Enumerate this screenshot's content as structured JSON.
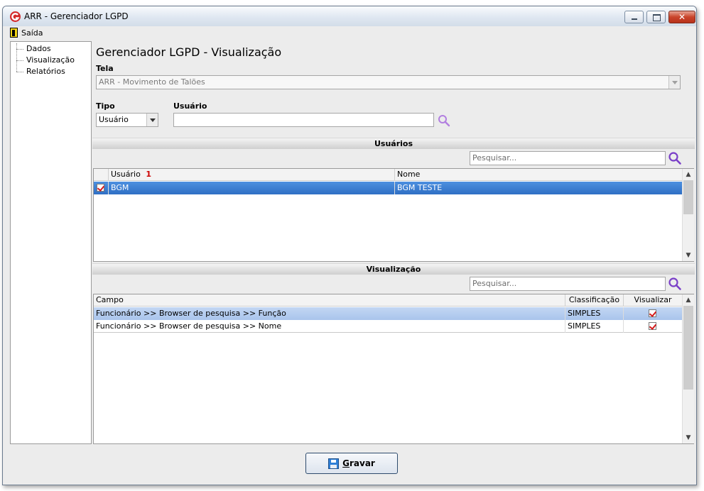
{
  "window": {
    "title": "ARR - Gerenciador LGPD"
  },
  "menu": {
    "exit_label": "Saída"
  },
  "sidebar": {
    "items": [
      {
        "label": "Dados"
      },
      {
        "label": "Visualização"
      },
      {
        "label": "Relatórios"
      }
    ]
  },
  "main": {
    "title": "Gerenciador LGPD - Visualização",
    "screen_label": "Tela",
    "screen_value": "ARR - Movimento de Talões",
    "type_label": "Tipo",
    "type_value": "Usuário",
    "user_label": "Usuário",
    "user_value": ""
  },
  "users_section": {
    "title": "Usuários",
    "search_placeholder": "Pesquisar...",
    "columns": [
      "Usuário",
      "Nome"
    ],
    "sort_indicator": "1",
    "rows": [
      {
        "checked": true,
        "user": "BGM",
        "name": "BGM TESTE"
      }
    ]
  },
  "view_section": {
    "title": "Visualização",
    "search_placeholder": "Pesquisar...",
    "columns": [
      "Campo",
      "Classificação",
      "Visualizar"
    ],
    "rows": [
      {
        "field": "Funcionário >> Browser de pesquisa >> Função",
        "classification": "SIMPLES",
        "visible": true
      },
      {
        "field": "Funcionário >> Browser de pesquisa >> Nome",
        "classification": "SIMPLES",
        "visible": true
      }
    ]
  },
  "footer": {
    "save_label": "Gravar"
  },
  "colors": {
    "selection": "#3a7fd5",
    "selection_light": "#b4cdf0",
    "accent_icon": "#7a3fc8",
    "close": "#c9442b"
  }
}
